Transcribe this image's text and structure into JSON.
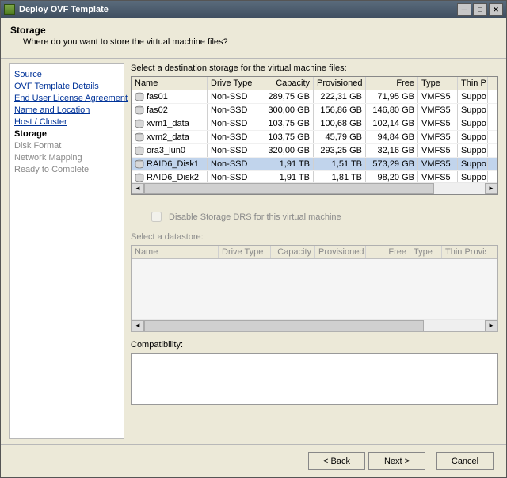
{
  "window": {
    "title": "Deploy OVF Template"
  },
  "header": {
    "title": "Storage",
    "subtitle": "Where do you want to store the virtual machine files?"
  },
  "nav": {
    "items": [
      {
        "label": "Source",
        "kind": "link"
      },
      {
        "label": "OVF Template Details",
        "kind": "link"
      },
      {
        "label": "End User License Agreement",
        "kind": "link"
      },
      {
        "label": "Name and Location",
        "kind": "link"
      },
      {
        "label": "Host / Cluster",
        "kind": "link"
      },
      {
        "label": "Storage",
        "kind": "current"
      },
      {
        "label": "Disk Format",
        "kind": "disabled"
      },
      {
        "label": "Network Mapping",
        "kind": "disabled"
      },
      {
        "label": "Ready to Complete",
        "kind": "disabled"
      }
    ]
  },
  "storage": {
    "section_label": "Select a destination storage for the virtual machine files:",
    "columns": {
      "name": "Name",
      "drive_type": "Drive Type",
      "capacity": "Capacity",
      "provisioned": "Provisioned",
      "free": "Free",
      "type": "Type",
      "thin": "Thin P"
    },
    "rows": [
      {
        "name": "fas01",
        "drive_type": "Non-SSD",
        "capacity": "289,75 GB",
        "provisioned": "222,31 GB",
        "free": "71,95 GB",
        "type": "VMFS5",
        "thin": "Suppo",
        "selected": false
      },
      {
        "name": "fas02",
        "drive_type": "Non-SSD",
        "capacity": "300,00 GB",
        "provisioned": "156,86 GB",
        "free": "146,80 GB",
        "type": "VMFS5",
        "thin": "Suppo",
        "selected": false
      },
      {
        "name": "xvm1_data",
        "drive_type": "Non-SSD",
        "capacity": "103,75 GB",
        "provisioned": "100,68 GB",
        "free": "102,14 GB",
        "type": "VMFS5",
        "thin": "Suppo",
        "selected": false
      },
      {
        "name": "xvm2_data",
        "drive_type": "Non-SSD",
        "capacity": "103,75 GB",
        "provisioned": "45,79 GB",
        "free": "94,84 GB",
        "type": "VMFS5",
        "thin": "Suppo",
        "selected": false
      },
      {
        "name": "ora3_lun0",
        "drive_type": "Non-SSD",
        "capacity": "320,00 GB",
        "provisioned": "293,25 GB",
        "free": "32,16 GB",
        "type": "VMFS5",
        "thin": "Suppo",
        "selected": false
      },
      {
        "name": "RAID6_Disk1",
        "drive_type": "Non-SSD",
        "capacity": "1,91 TB",
        "provisioned": "1,51 TB",
        "free": "573,29 GB",
        "type": "VMFS5",
        "thin": "Suppo",
        "selected": true
      },
      {
        "name": "RAID6_Disk2",
        "drive_type": "Non-SSD",
        "capacity": "1,91 TB",
        "provisioned": "1,81 TB",
        "free": "98,20 GB",
        "type": "VMFS5",
        "thin": "Suppo",
        "selected": false
      }
    ],
    "drs_checkbox_label": "Disable Storage DRS for this virtual machine",
    "datastore_section_label": "Select a datastore:",
    "datastore_columns": {
      "name": "Name",
      "drive_type": "Drive Type",
      "capacity": "Capacity",
      "provisioned": "Provisioned",
      "free": "Free",
      "type": "Type",
      "thin": "Thin Provis"
    },
    "compat_label": "Compatibility:"
  },
  "footer": {
    "back": "< Back",
    "next": "Next >",
    "cancel": "Cancel"
  }
}
